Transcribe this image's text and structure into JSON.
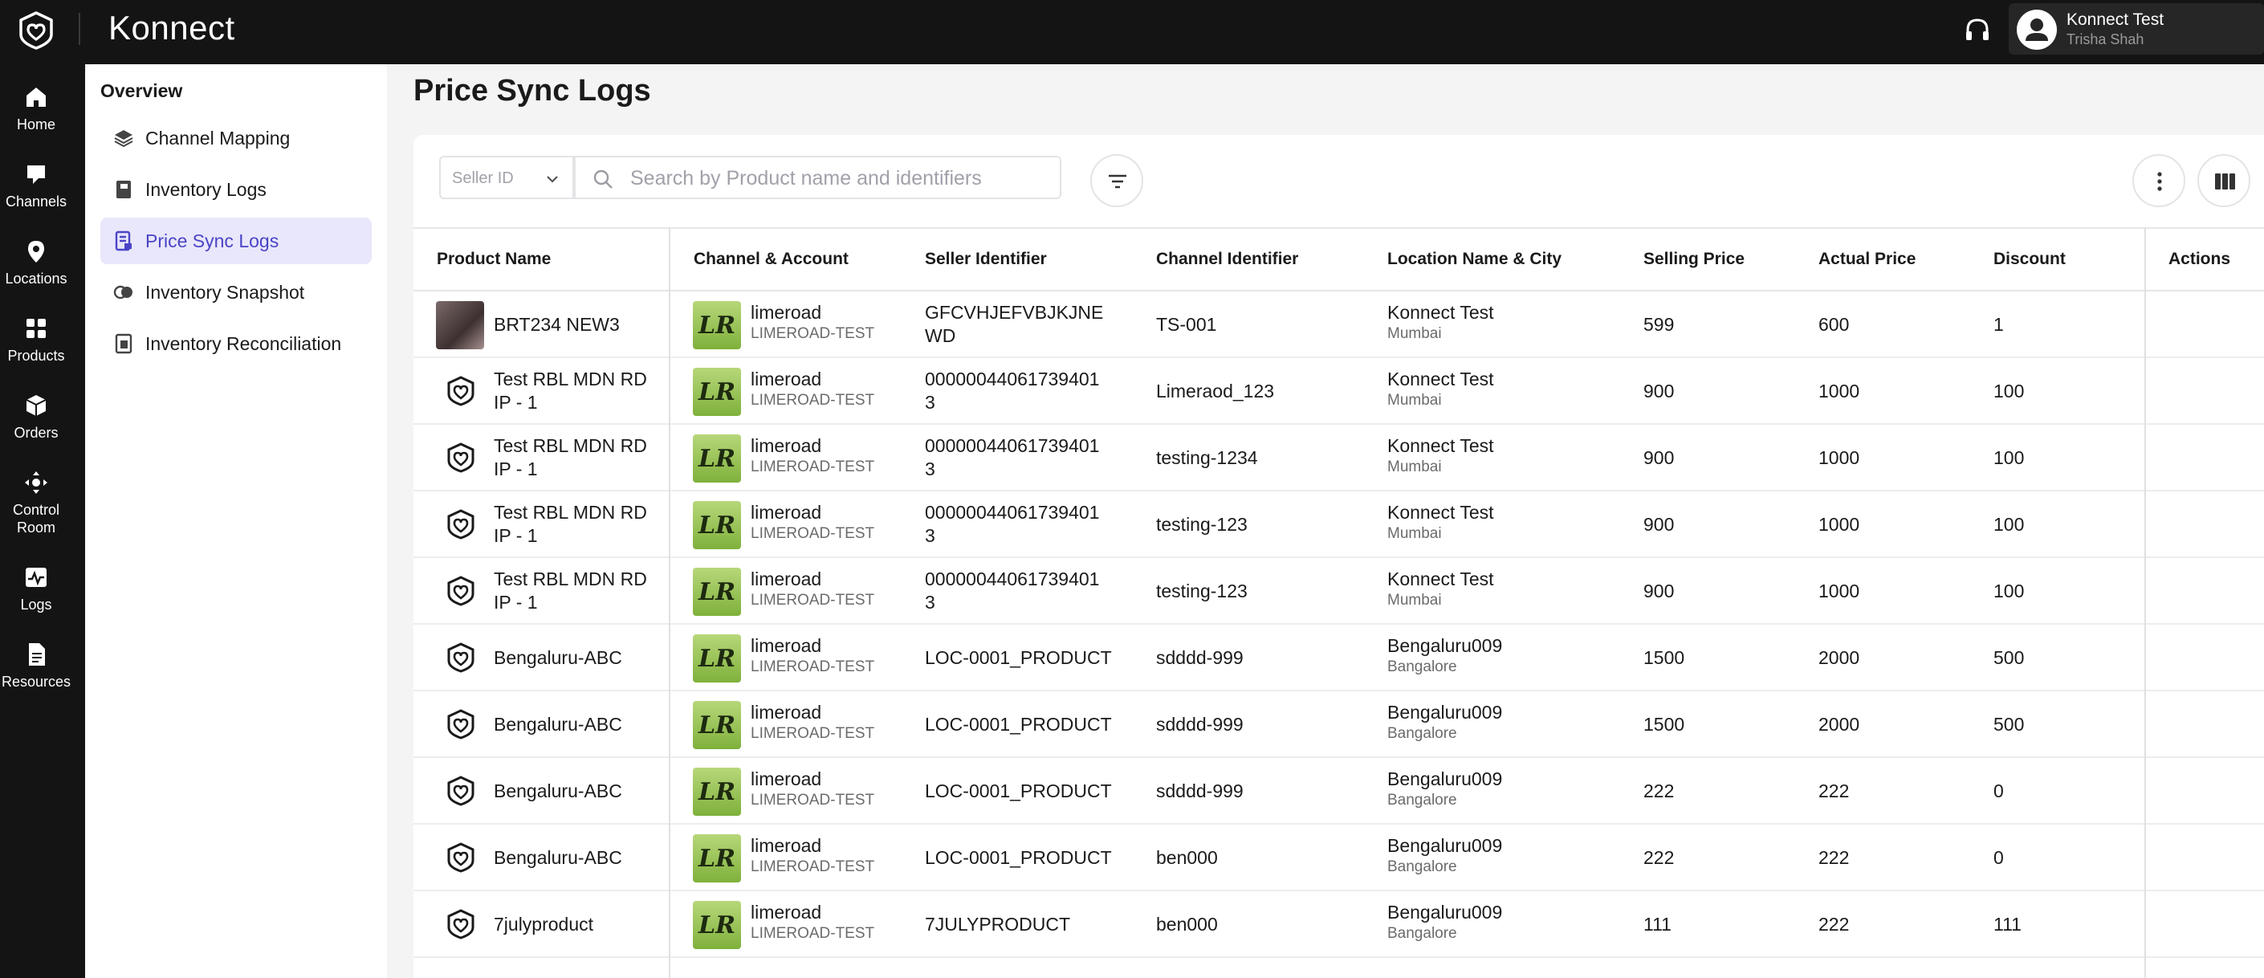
{
  "app": {
    "name": "Konnect"
  },
  "header": {
    "user": {
      "name": "Konnect Test",
      "subtitle": "Trisha Shah"
    }
  },
  "rail": [
    {
      "label": "Home",
      "icon": "home-icon"
    },
    {
      "label": "Channels",
      "icon": "channels-icon"
    },
    {
      "label": "Locations",
      "icon": "location-pin-icon"
    },
    {
      "label": "Products",
      "icon": "products-icon"
    },
    {
      "label": "Orders",
      "icon": "orders-box-icon"
    },
    {
      "label": "Control",
      "label2": "Room",
      "icon": "control-room-icon"
    },
    {
      "label": "Logs",
      "icon": "logs-icon"
    },
    {
      "label": "Resources",
      "icon": "resources-icon"
    }
  ],
  "subnav": {
    "title": "Overview",
    "items": [
      {
        "label": "Channel Mapping",
        "icon": "layers-icon"
      },
      {
        "label": "Inventory Logs",
        "icon": "notebook-icon"
      },
      {
        "label": "Price Sync Logs",
        "icon": "price-log-icon",
        "active": true
      },
      {
        "label": "Inventory Snapshot",
        "icon": "snapshot-icon"
      },
      {
        "label": "Inventory Reconciliation",
        "icon": "reconciliation-icon"
      }
    ]
  },
  "page": {
    "title": "Price Sync Logs"
  },
  "filters": {
    "seller_placeholder": "Seller ID",
    "search_placeholder": "Search by Product name and identifiers"
  },
  "table": {
    "headers": [
      "Product Name",
      "Channel & Account",
      "Seller Identifier",
      "Channel Identifier",
      "Location Name & City",
      "Selling Price",
      "Actual Price",
      "Discount",
      "Actions"
    ],
    "rows": [
      {
        "product": "BRT234 NEW3",
        "product2": "",
        "channel": "limeroad",
        "account": "LIMEROAD-TEST",
        "seller_id": "GFCVHJEFVBJKJNE",
        "seller_id2": "WD",
        "channel_id": "TS-001",
        "location": "Konnect Test",
        "city": "Mumbai",
        "selling": "599",
        "actual": "600",
        "discount": "1",
        "has_image": true
      },
      {
        "product": "Test RBL MDN RD",
        "product2": "IP - 1",
        "channel": "limeroad",
        "account": "LIMEROAD-TEST",
        "seller_id": "00000044061739401",
        "seller_id2": "3",
        "channel_id": "Limeraod_123",
        "location": "Konnect Test",
        "city": "Mumbai",
        "selling": "900",
        "actual": "1000",
        "discount": "100"
      },
      {
        "product": "Test RBL MDN RD",
        "product2": "IP - 1",
        "channel": "limeroad",
        "account": "LIMEROAD-TEST",
        "seller_id": "00000044061739401",
        "seller_id2": "3",
        "channel_id": "testing-1234",
        "location": "Konnect Test",
        "city": "Mumbai",
        "selling": "900",
        "actual": "1000",
        "discount": "100"
      },
      {
        "product": "Test RBL MDN RD",
        "product2": "IP - 1",
        "channel": "limeroad",
        "account": "LIMEROAD-TEST",
        "seller_id": "00000044061739401",
        "seller_id2": "3",
        "channel_id": "testing-123",
        "location": "Konnect Test",
        "city": "Mumbai",
        "selling": "900",
        "actual": "1000",
        "discount": "100"
      },
      {
        "product": "Test RBL MDN RD",
        "product2": "IP - 1",
        "channel": "limeroad",
        "account": "LIMEROAD-TEST",
        "seller_id": "00000044061739401",
        "seller_id2": "3",
        "channel_id": "testing-123",
        "location": "Konnect Test",
        "city": "Mumbai",
        "selling": "900",
        "actual": "1000",
        "discount": "100"
      },
      {
        "product": "Bengaluru-ABC",
        "product2": "",
        "channel": "limeroad",
        "account": "LIMEROAD-TEST",
        "seller_id": "LOC-0001_PRODUCT",
        "seller_id2": "",
        "channel_id": "sdddd-999",
        "location": "Bengaluru009",
        "city": "Bangalore",
        "selling": "1500",
        "actual": "2000",
        "discount": "500"
      },
      {
        "product": "Bengaluru-ABC",
        "product2": "",
        "channel": "limeroad",
        "account": "LIMEROAD-TEST",
        "seller_id": "LOC-0001_PRODUCT",
        "seller_id2": "",
        "channel_id": "sdddd-999",
        "location": "Bengaluru009",
        "city": "Bangalore",
        "selling": "1500",
        "actual": "2000",
        "discount": "500"
      },
      {
        "product": "Bengaluru-ABC",
        "product2": "",
        "channel": "limeroad",
        "account": "LIMEROAD-TEST",
        "seller_id": "LOC-0001_PRODUCT",
        "seller_id2": "",
        "channel_id": "sdddd-999",
        "location": "Bengaluru009",
        "city": "Bangalore",
        "selling": "222",
        "actual": "222",
        "discount": "0"
      },
      {
        "product": "Bengaluru-ABC",
        "product2": "",
        "channel": "limeroad",
        "account": "LIMEROAD-TEST",
        "seller_id": "LOC-0001_PRODUCT",
        "seller_id2": "",
        "channel_id": "ben000",
        "location": "Bengaluru009",
        "city": "Bangalore",
        "selling": "222",
        "actual": "222",
        "discount": "0"
      },
      {
        "product": "7julyproduct",
        "product2": "",
        "channel": "limeroad",
        "account": "LIMEROAD-TEST",
        "seller_id": "7JULYPRODUCT",
        "seller_id2": "",
        "channel_id": "ben000",
        "location": "Bengaluru009",
        "city": "Bangalore",
        "selling": "111",
        "actual": "222",
        "discount": "111"
      }
    ]
  },
  "colors": {
    "accent": "#4a44c6",
    "active_bg": "#e9e7fb",
    "topbar": "#141414"
  }
}
